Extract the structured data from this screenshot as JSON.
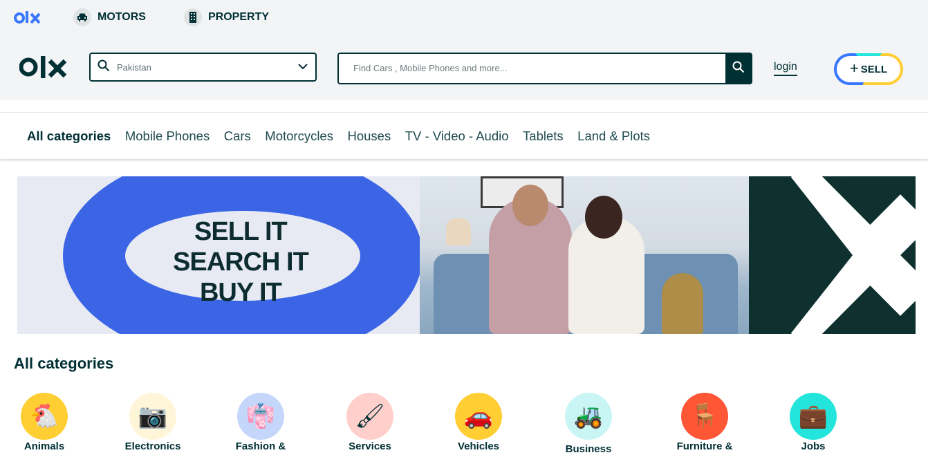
{
  "header": {
    "nav": [
      {
        "label": "MOTORS",
        "icon": "car-icon"
      },
      {
        "label": "PROPERTY",
        "icon": "building-icon"
      }
    ],
    "location": {
      "value": "Pakistan",
      "icon": "search-icon"
    },
    "search": {
      "placeholder": "Find Cars , Mobile Phones and more..."
    },
    "login_label": "login",
    "sell_label": "SELL"
  },
  "category_bar": [
    "All categories",
    "Mobile Phones",
    "Cars",
    "Motorcycles",
    "Houses",
    "TV - Video - Audio",
    "Tablets",
    "Land & Plots"
  ],
  "banner": {
    "lines": [
      "SELL IT",
      "SEARCH IT",
      "BUY IT"
    ]
  },
  "all_categories": {
    "title": "All categories",
    "items": [
      {
        "label": "Animals",
        "icon": "chicken-icon",
        "color": "#ffce32"
      },
      {
        "label": "Electronics",
        "icon": "camera-icon",
        "color": "#fff6d9"
      },
      {
        "label": "Fashion &",
        "icon": "dress-icon",
        "color": "#c5d6fb"
      },
      {
        "label": "Services",
        "icon": "paint-roller-icon",
        "color": "#ffcfcb"
      },
      {
        "label": "Vehicles",
        "icon": "car-icon",
        "color": "#ffce32"
      },
      {
        "label": "Business",
        "icon": "tractor-icon",
        "color": "#c9f6f4"
      },
      {
        "label": "Furniture &",
        "icon": "chair-icon",
        "color": "#ff5636"
      },
      {
        "label": "Jobs",
        "icon": "briefcase-icon",
        "color": "#23e5db"
      }
    ]
  },
  "colors": {
    "brand_dark": "#002f34",
    "header_bg": "#f2f4f5",
    "blue": "#3a77ff",
    "cyan": "#23e5db",
    "yellow": "#ffce32"
  }
}
